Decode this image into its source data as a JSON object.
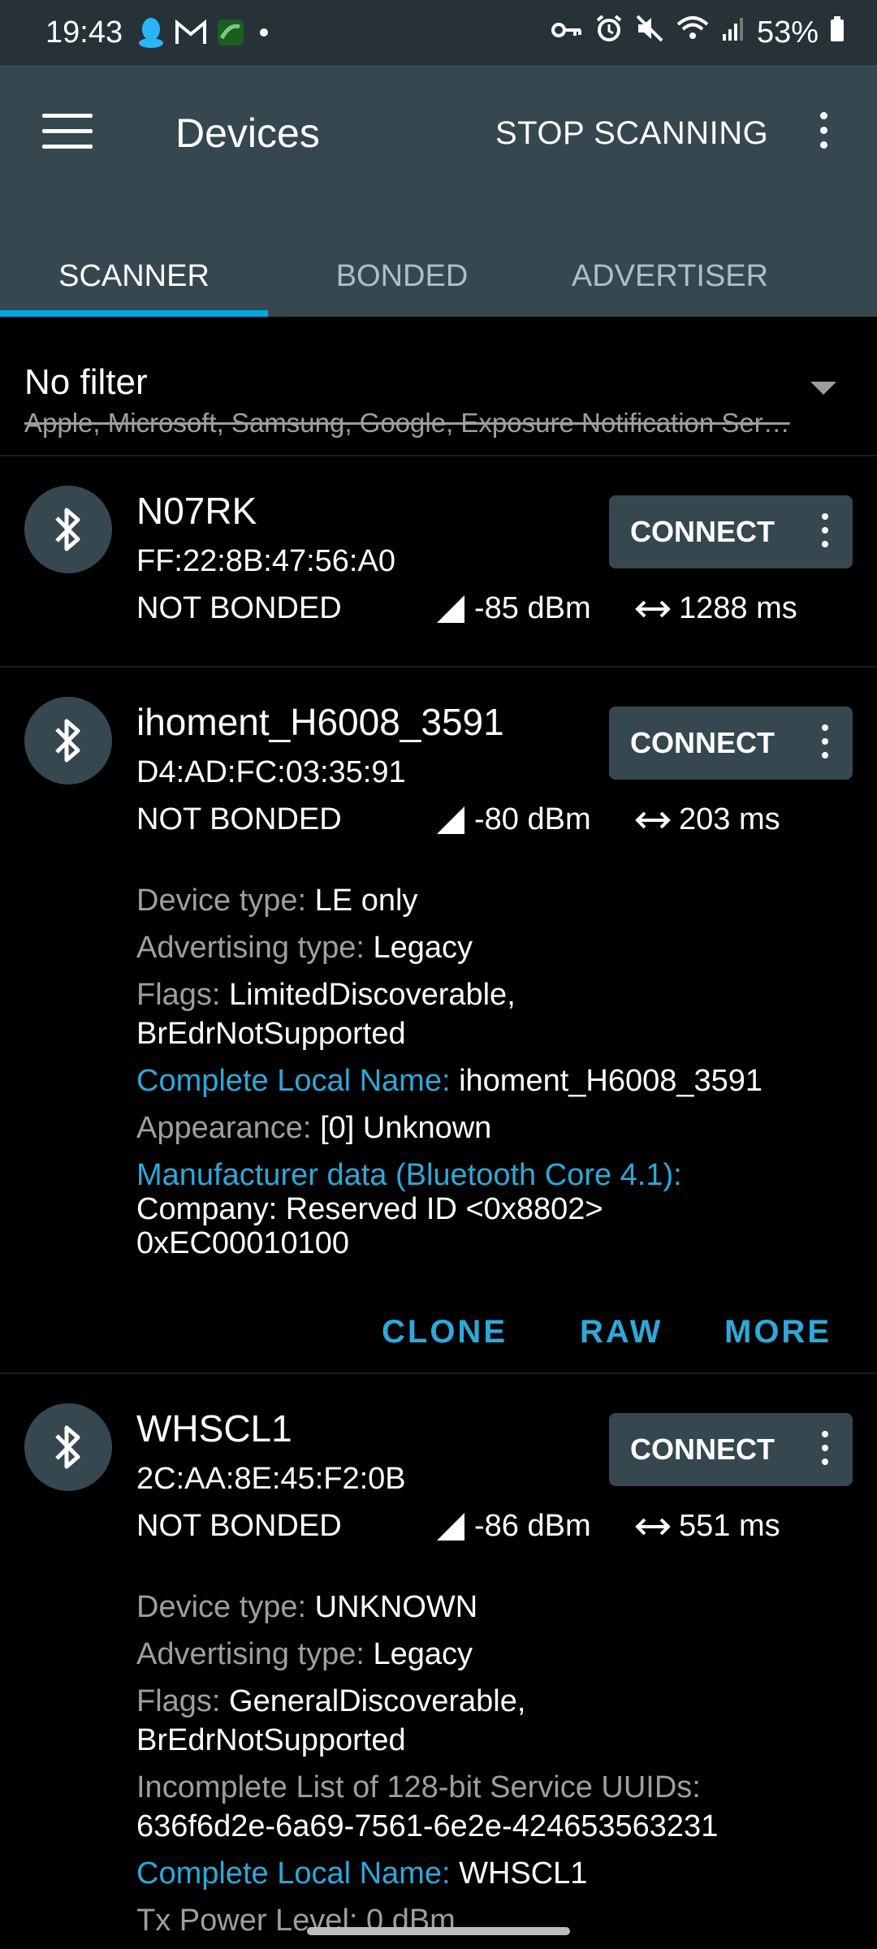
{
  "status_bar": {
    "time": "19:43",
    "battery": "53%",
    "icons_left": [
      "qq-icon",
      "gmail-icon",
      "app-icon",
      "dot-icon"
    ],
    "icons_right": [
      "vpn-key-icon",
      "alarm-icon",
      "mute-icon",
      "wifi-icon",
      "signal-icon",
      "battery-icon"
    ]
  },
  "app_bar": {
    "title": "Devices",
    "stop_label": "STOP SCANNING"
  },
  "tabs": [
    {
      "label": "SCANNER",
      "active": true
    },
    {
      "label": "BONDED",
      "active": false
    },
    {
      "label": "ADVERTISER",
      "active": false
    }
  ],
  "filter": {
    "title": "No filter",
    "subtitle": "Apple, Microsoft, Samsung, Google, Exposure Notification Ser…"
  },
  "connect_label": "CONNECT",
  "devices": [
    {
      "name": "N07RK",
      "mac": "FF:22:8B:47:56:A0",
      "bond": "NOT BONDED",
      "rssi": "-85 dBm",
      "interval": "1288 ms"
    },
    {
      "name": "ihoment_H6008_3591",
      "mac": "D4:AD:FC:03:35:91",
      "bond": "NOT BONDED",
      "rssi": "-80 dBm",
      "interval": "203 ms",
      "details": {
        "device_type_label": "Device type: ",
        "device_type": "LE only",
        "adv_type_label": "Advertising type: ",
        "adv_type": "Legacy",
        "flags_label": "Flags: ",
        "flags_1": "LimitedDiscoverable,",
        "flags_2": "BrEdrNotSupported",
        "local_name_label": "Complete Local Name: ",
        "local_name": "ihoment_H6008_3591",
        "appearance_label": "Appearance: ",
        "appearance": "[0] Unknown",
        "mfr_label": "Manufacturer data (Bluetooth Core 4.1):",
        "mfr_company": "Company: Reserved ID <0x8802>",
        "mfr_data": "0xEC00010100"
      },
      "actions": {
        "clone": "CLONE",
        "raw": "RAW",
        "more": "MORE"
      }
    },
    {
      "name": "WHSCL1",
      "mac": "2C:AA:8E:45:F2:0B",
      "bond": "NOT BONDED",
      "rssi": "-86 dBm",
      "interval": "551 ms",
      "details": {
        "device_type_label": "Device type: ",
        "device_type": "UNKNOWN",
        "adv_type_label": "Advertising type: ",
        "adv_type": "Legacy",
        "flags_label": "Flags: ",
        "flags_1": "GeneralDiscoverable,",
        "flags_2": "BrEdrNotSupported",
        "uuids_label": "Incomplete List of 128-bit Service UUIDs:",
        "uuids": "636f6d2e-6a69-7561-6e2e-424653563231",
        "local_name_label": "Complete Local Name: ",
        "local_name": "WHSCL1",
        "tx_power_label": "Tx Power Level: ",
        "tx_power": "0 dBm"
      }
    }
  ],
  "colors": {
    "status_bar": "#263238",
    "app_bar": "#37474f",
    "accent": "#00a8e1",
    "link": "#2ea8d8",
    "background": "#000000"
  }
}
